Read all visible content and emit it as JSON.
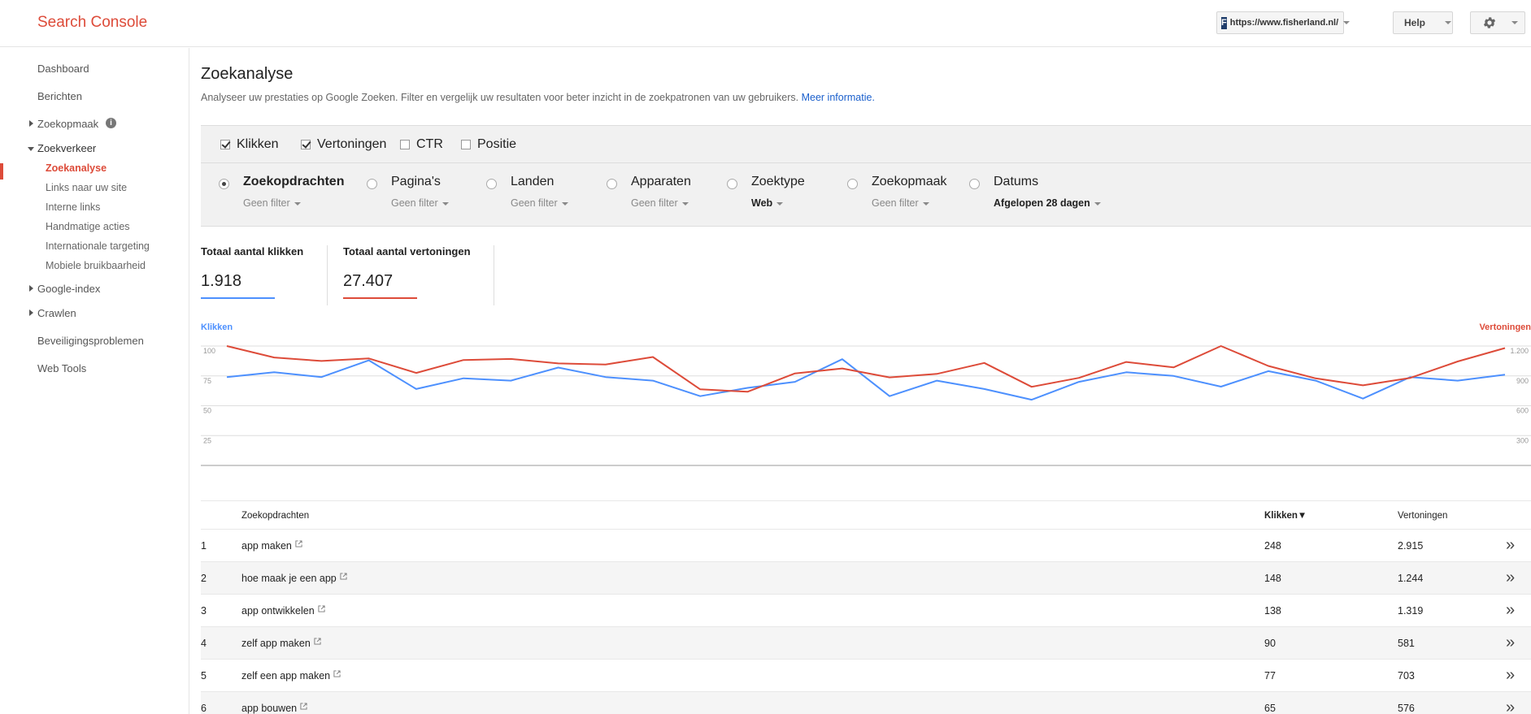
{
  "header": {
    "logo": "Search Console",
    "site": {
      "favicon_letter": "F",
      "url": "https://www.fisherland.nl/"
    },
    "help_label": "Help"
  },
  "sidebar": {
    "items": [
      {
        "label": "Dashboard"
      },
      {
        "label": "Berichten"
      },
      {
        "label": "Zoekopmaak"
      },
      {
        "label": "Zoekverkeer"
      },
      {
        "label": "Google-index"
      },
      {
        "label": "Crawlen"
      },
      {
        "label": "Beveiligingsproblemen"
      },
      {
        "label": "Web Tools"
      }
    ],
    "subitems": [
      {
        "label": "Zoekanalyse"
      },
      {
        "label": "Links naar uw site"
      },
      {
        "label": "Interne links"
      },
      {
        "label": "Handmatige acties"
      },
      {
        "label": "Internationale targeting"
      },
      {
        "label": "Mobiele bruikbaarheid"
      }
    ],
    "info_glyph": "i"
  },
  "main": {
    "title": "Zoekanalyse",
    "description": "Analyseer uw prestaties op Google Zoeken. Filter en vergelijk uw resultaten voor beter inzicht in de zoekpatronen van uw gebruikers.",
    "more_link": "Meer informatie."
  },
  "metrics": [
    {
      "label": "Klikken",
      "checked": true
    },
    {
      "label": "Vertoningen",
      "checked": true
    },
    {
      "label": "CTR",
      "checked": false
    },
    {
      "label": "Positie",
      "checked": false
    }
  ],
  "dimensions": [
    {
      "label": "Zoekopdrachten",
      "filter": "Geen filter",
      "selected": true
    },
    {
      "label": "Pagina's",
      "filter": "Geen filter",
      "selected": false
    },
    {
      "label": "Landen",
      "filter": "Geen filter",
      "selected": false
    },
    {
      "label": "Apparaten",
      "filter": "Geen filter",
      "selected": false
    },
    {
      "label": "Zoektype",
      "filter": "Web",
      "selected": false
    },
    {
      "label": "Zoekopmaak",
      "filter": "Geen filter",
      "selected": false
    },
    {
      "label": "Datums",
      "filter": "Afgelopen 28 dagen",
      "selected": false
    }
  ],
  "totals": {
    "clicks_label": "Totaal aantal klikken",
    "clicks_value": "1.918",
    "impressions_label": "Totaal aantal vertoningen",
    "impressions_value": "27.407"
  },
  "colors": {
    "clicks": "#4d90fe",
    "impressions": "#dd4b39",
    "accent": "#dd4b39"
  },
  "chart_data": {
    "type": "line",
    "left_axis_label": "Klikken",
    "right_axis_label": "Vertoningen",
    "left_ticks": [
      "100",
      "75",
      "50",
      "25"
    ],
    "right_ticks": [
      "1.200",
      "900",
      "600",
      "300"
    ],
    "left_range": [
      0,
      100
    ],
    "right_range": [
      0,
      1200
    ],
    "series": [
      {
        "name": "Klikken",
        "axis": "left",
        "values": [
          74,
          78,
          74,
          88,
          64,
          73,
          71,
          82,
          74,
          71,
          58,
          65,
          70,
          89,
          58,
          71,
          64,
          55,
          70,
          78,
          75,
          66,
          79,
          71,
          56,
          74,
          71,
          76
        ]
      },
      {
        "name": "Vertoningen",
        "axis": "right",
        "values": [
          1200,
          1085,
          1050,
          1075,
          930,
          1060,
          1070,
          1025,
          1015,
          1090,
          765,
          740,
          925,
          975,
          885,
          920,
          1030,
          790,
          880,
          1040,
          985,
          1200,
          1000,
          875,
          805,
          880,
          1045,
          1180
        ]
      }
    ],
    "grid": true
  },
  "table": {
    "headers": {
      "query": "Zoekopdrachten",
      "clicks": "Klikken",
      "sort": "▼",
      "impressions": "Vertoningen"
    },
    "rows": [
      {
        "idx": "1",
        "query": "app maken",
        "clicks": "248",
        "impressions": "2.915"
      },
      {
        "idx": "2",
        "query": "hoe maak je een app",
        "clicks": "148",
        "impressions": "1.244"
      },
      {
        "idx": "3",
        "query": "app ontwikkelen",
        "clicks": "138",
        "impressions": "1.319"
      },
      {
        "idx": "4",
        "query": "zelf app maken",
        "clicks": "90",
        "impressions": "581"
      },
      {
        "idx": "5",
        "query": "zelf een app maken",
        "clicks": "77",
        "impressions": "703"
      },
      {
        "idx": "6",
        "query": "app bouwen",
        "clicks": "65",
        "impressions": "576"
      }
    ],
    "detail_glyph": "»"
  }
}
